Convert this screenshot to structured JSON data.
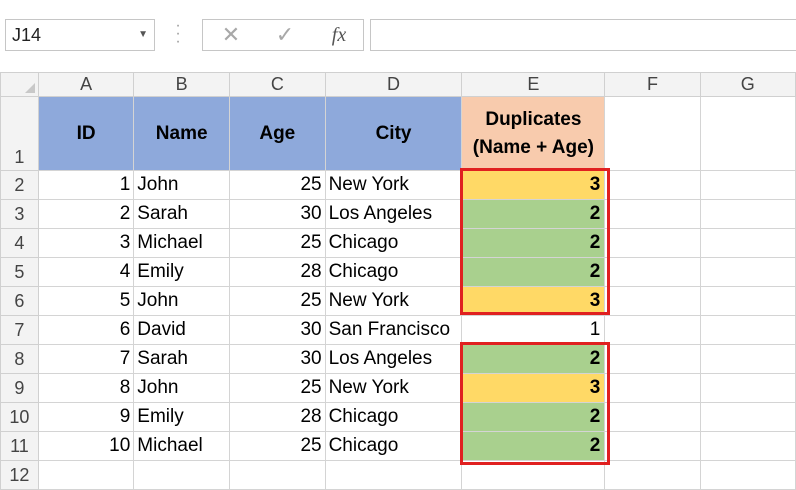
{
  "formula_bar": {
    "name_box": "J14",
    "cancel_icon": "✕",
    "enter_icon": "✓",
    "fx_label": "fx",
    "formula": ""
  },
  "columns": [
    "A",
    "B",
    "C",
    "D",
    "E",
    "F",
    "G"
  ],
  "rows": [
    "1",
    "2",
    "3",
    "4",
    "5",
    "6",
    "7",
    "8",
    "9",
    "10",
    "11",
    "12"
  ],
  "header": {
    "id": "ID",
    "name": "Name",
    "age": "Age",
    "city": "City",
    "dupes_line1": "Duplicates",
    "dupes_line2": "(Name + Age)"
  },
  "data": [
    {
      "id": "1",
      "name": "John",
      "age": "25",
      "city": "New York",
      "dupes": "3",
      "highlight": "yellow"
    },
    {
      "id": "2",
      "name": "Sarah",
      "age": "30",
      "city": "Los Angeles",
      "dupes": "2",
      "highlight": "green"
    },
    {
      "id": "3",
      "name": "Michael",
      "age": "25",
      "city": "Chicago",
      "dupes": "2",
      "highlight": "green"
    },
    {
      "id": "4",
      "name": "Emily",
      "age": "28",
      "city": "Chicago",
      "dupes": "2",
      "highlight": "green"
    },
    {
      "id": "5",
      "name": "John",
      "age": "25",
      "city": "New York",
      "dupes": "3",
      "highlight": "yellow"
    },
    {
      "id": "6",
      "name": "David",
      "age": "30",
      "city": "San Francisco",
      "dupes": "1",
      "highlight": "none"
    },
    {
      "id": "7",
      "name": "Sarah",
      "age": "30",
      "city": "Los Angeles",
      "dupes": "2",
      "highlight": "green"
    },
    {
      "id": "8",
      "name": "John",
      "age": "25",
      "city": "New York",
      "dupes": "3",
      "highlight": "yellow"
    },
    {
      "id": "9",
      "name": "Emily",
      "age": "28",
      "city": "Chicago",
      "dupes": "2",
      "highlight": "green"
    },
    {
      "id": "10",
      "name": "Michael",
      "age": "25",
      "city": "Chicago",
      "dupes": "2",
      "highlight": "green"
    }
  ],
  "colors": {
    "header_blue": "#8ea9db",
    "header_peach": "#f8cbad",
    "dupe_yellow": "#ffd966",
    "dupe_green": "#a9d08e",
    "outline_red": "#e02020"
  }
}
